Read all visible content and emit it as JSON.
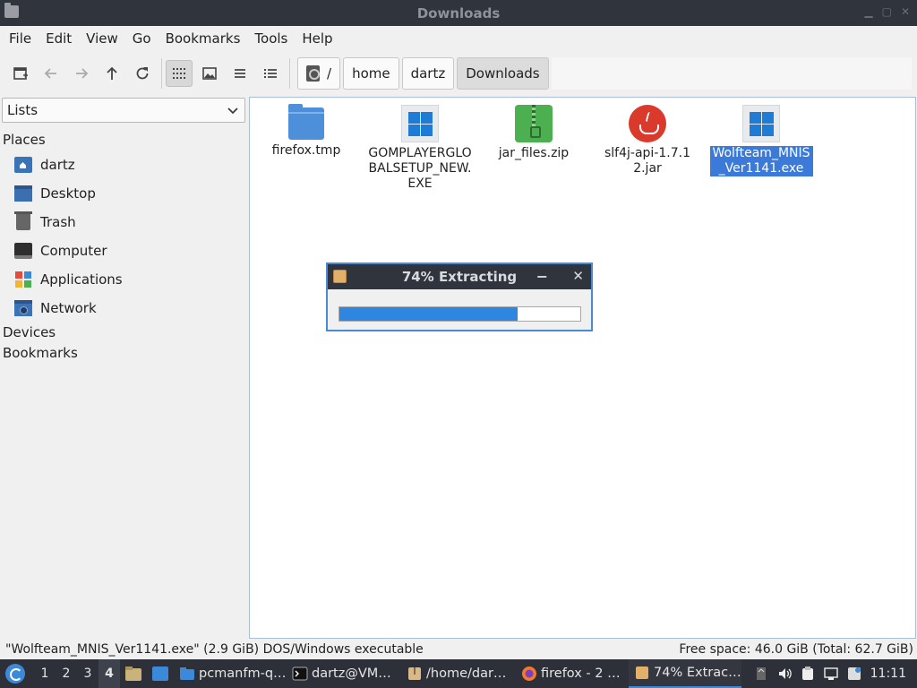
{
  "window": {
    "title": "Downloads"
  },
  "menu": [
    "File",
    "Edit",
    "View",
    "Go",
    "Bookmarks",
    "Tools",
    "Help"
  ],
  "breadcrumb": {
    "root": "/",
    "items": [
      "home",
      "dartz",
      "Downloads"
    ]
  },
  "sidebar": {
    "selector": "Lists",
    "places_heading": "Places",
    "places": [
      "dartz",
      "Desktop",
      "Trash",
      "Computer",
      "Applications",
      "Network"
    ],
    "devices_heading": "Devices",
    "bookmarks_heading": "Bookmarks"
  },
  "files": [
    {
      "name": "firefox.tmp",
      "icon": "folder-icon"
    },
    {
      "name": "GOMPLAYERGLOBALSETUP_NEW.EXE",
      "icon": "windows-exe-icon"
    },
    {
      "name": "jar_files.zip",
      "icon": "zip-archive-icon"
    },
    {
      "name": "slf4j-api-1.7.12.jar",
      "icon": "java-jar-icon"
    },
    {
      "name": "Wolfteam_MNIS_Ver1141.exe",
      "icon": "windows-exe-icon",
      "selected": true
    }
  ],
  "dialog": {
    "title": "74% Extracting",
    "progress": 0.74
  },
  "status": {
    "left": "\"Wolfteam_MNIS_Ver1141.exe\" (2.9 GiB) DOS/Windows executable",
    "right": "Free space: 46.0 GiB (Total: 62.7 GiB)"
  },
  "taskbar": {
    "workspaces": [
      "1",
      "2",
      "3",
      "4"
    ],
    "active_workspace": "4",
    "tasks": [
      {
        "label": "pcmanfm-q…"
      },
      {
        "label": "dartz@VM…"
      },
      {
        "label": "/home/dar…"
      },
      {
        "label": "firefox - 2 …"
      },
      {
        "label": "74% Extrac…",
        "active": true
      }
    ],
    "clock": "11:11"
  },
  "colors": {
    "accent": "#3b7ad8",
    "titlebar": "#30343d",
    "progress": "#2f86e0"
  }
}
